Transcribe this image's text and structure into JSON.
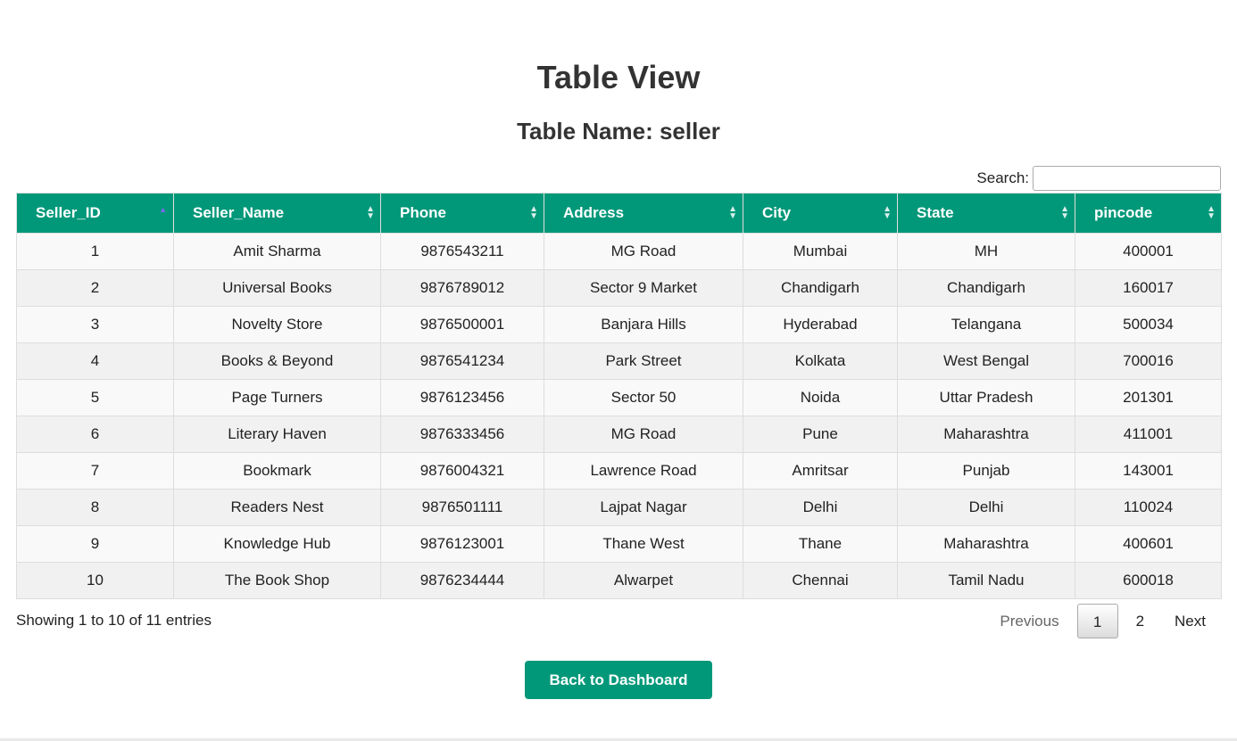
{
  "page": {
    "title": "Table View",
    "subtitle": "Table Name: seller"
  },
  "search": {
    "label": "Search:",
    "value": ""
  },
  "table": {
    "columns": [
      "Seller_ID",
      "Seller_Name",
      "Phone",
      "Address",
      "City",
      "State",
      "pincode"
    ],
    "sorted_column": "Seller_ID",
    "sort_direction": "ascending",
    "rows": [
      [
        "1",
        "Amit Sharma",
        "9876543211",
        "MG Road",
        "Mumbai",
        "MH",
        "400001"
      ],
      [
        "2",
        "Universal Books",
        "9876789012",
        "Sector 9 Market",
        "Chandigarh",
        "Chandigarh",
        "160017"
      ],
      [
        "3",
        "Novelty Store",
        "9876500001",
        "Banjara Hills",
        "Hyderabad",
        "Telangana",
        "500034"
      ],
      [
        "4",
        "Books & Beyond",
        "9876541234",
        "Park Street",
        "Kolkata",
        "West Bengal",
        "700016"
      ],
      [
        "5",
        "Page Turners",
        "9876123456",
        "Sector 50",
        "Noida",
        "Uttar Pradesh",
        "201301"
      ],
      [
        "6",
        "Literary Haven",
        "9876333456",
        "MG Road",
        "Pune",
        "Maharashtra",
        "411001"
      ],
      [
        "7",
        "Bookmark",
        "9876004321",
        "Lawrence Road",
        "Amritsar",
        "Punjab",
        "143001"
      ],
      [
        "8",
        "Readers Nest",
        "9876501111",
        "Lajpat Nagar",
        "Delhi",
        "Delhi",
        "110024"
      ],
      [
        "9",
        "Knowledge Hub",
        "9876123001",
        "Thane West",
        "Thane",
        "Maharashtra",
        "400601"
      ],
      [
        "10",
        "The Book Shop",
        "9876234444",
        "Alwarpet",
        "Chennai",
        "Tamil Nadu",
        "600018"
      ]
    ]
  },
  "info": "Showing 1 to 10 of 11 entries",
  "pagination": {
    "previous": "Previous",
    "pages": [
      "1",
      "2"
    ],
    "current": "1",
    "next": "Next"
  },
  "back_button": "Back to Dashboard",
  "colors": {
    "accent": "#009879",
    "sort_active": "#7b68ee"
  }
}
